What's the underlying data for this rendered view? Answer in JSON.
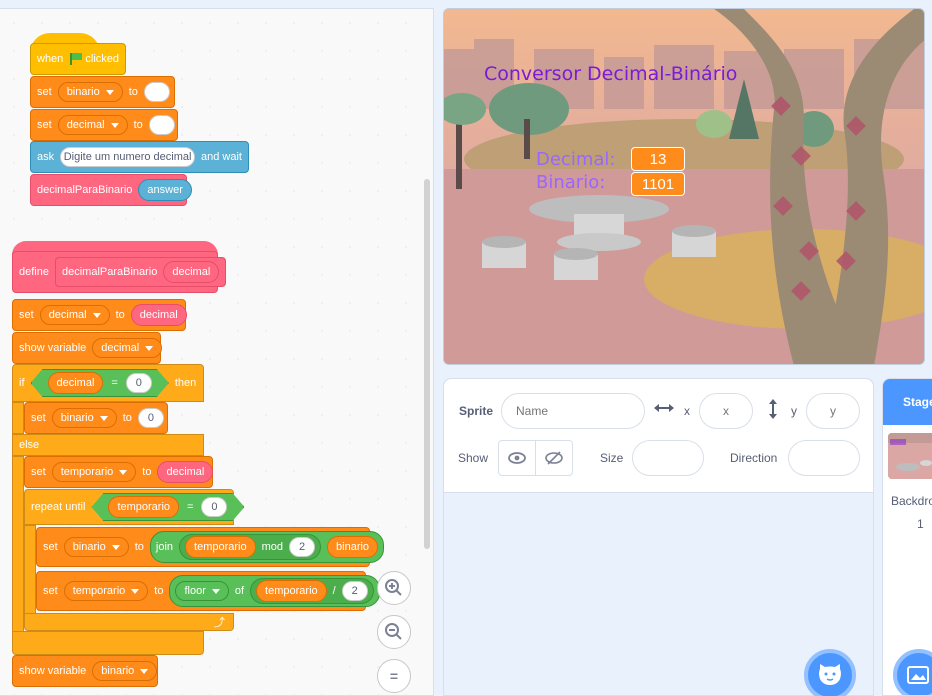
{
  "script1": {
    "when": "when",
    "clicked": "clicked",
    "set1": {
      "label": "set",
      "var": "binario",
      "to": "to",
      "value": ""
    },
    "set2": {
      "label": "set",
      "var": "decimal",
      "to": "to",
      "value": ""
    },
    "ask": {
      "label": "ask",
      "prompt": "Digite um numero decimal",
      "suffix": "and wait"
    },
    "call": {
      "name": "decimalParaBinario",
      "arg": "answer"
    }
  },
  "script2": {
    "define": "define",
    "proc_name": "decimalParaBinario",
    "param": "decimal",
    "set_dec": {
      "label": "set",
      "var": "decimal",
      "to": "to",
      "value": "decimal"
    },
    "show_dec": {
      "label": "show variable",
      "var": "decimal"
    },
    "if": {
      "label": "if",
      "left": "decimal",
      "eq": "=",
      "right": "0",
      "then": "then"
    },
    "set_bin0": {
      "label": "set",
      "var": "binario",
      "to": "to",
      "value": "0"
    },
    "else": "else",
    "set_temp": {
      "label": "set",
      "var": "temporario",
      "to": "to",
      "value": "decimal"
    },
    "repeat": {
      "label": "repeat until",
      "left": "temporario",
      "eq": "=",
      "right": "0"
    },
    "set_join": {
      "label": "set",
      "var": "binario",
      "to": "to",
      "join": "join",
      "a": "temporario",
      "mod": "mod",
      "b": "2",
      "c": "binario"
    },
    "set_floor": {
      "label": "set",
      "var": "temporario",
      "to": "to",
      "func": "floor",
      "of": "of",
      "a": "temporario",
      "div": "/",
      "b": "2"
    },
    "show_bin": {
      "label": "show variable",
      "var": "binario"
    }
  },
  "zoom": {
    "in": "+",
    "out": "−",
    "reset": "="
  },
  "stage": {
    "title": "Conversor Decimal-Binário",
    "decimal_label": "Decimal:",
    "decimal_value": "13",
    "binario_label": "Binario:",
    "binario_value": "1101"
  },
  "sprite_info": {
    "sprite_label": "Sprite",
    "name_placeholder": "Name",
    "x_label": "x",
    "x_placeholder": "x",
    "y_label": "y",
    "y_placeholder": "y",
    "show_label": "Show",
    "size_label": "Size",
    "direction_label": "Direction"
  },
  "stage_pane": {
    "header": "Stage",
    "backdrops_label": "Backdro",
    "backdrops_count": "1"
  },
  "colors": {
    "accent": "#4c97ff",
    "events": "#ffbf00",
    "variables": "#ff8c1a",
    "sensing": "#5cb1d6",
    "my_blocks": "#ff6680",
    "control": "#ffab19",
    "operators": "#59c059"
  }
}
